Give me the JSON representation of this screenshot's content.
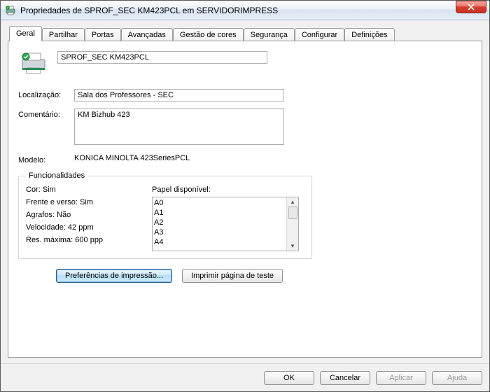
{
  "window": {
    "title": "Propriedades de SPROF_SEC KM423PCL em SERVIDORIMPRESS"
  },
  "tabs": [
    {
      "label": "Geral"
    },
    {
      "label": "Partilhar"
    },
    {
      "label": "Portas"
    },
    {
      "label": "Avançadas"
    },
    {
      "label": "Gestão de cores"
    },
    {
      "label": "Segurança"
    },
    {
      "label": "Configurar"
    },
    {
      "label": "Definições"
    }
  ],
  "general": {
    "name_value": "SPROF_SEC KM423PCL",
    "location_label": "Localização:",
    "location_value": "Sala dos Professores - SEC",
    "comment_label": "Comentário:",
    "comment_value": "KM Bizhub 423",
    "model_label": "Modelo:",
    "model_value": "KONICA MINOLTA 423SeriesPCL"
  },
  "features": {
    "legend": "Funcionalidades",
    "color": "Cor: Sim",
    "duplex": "Frente e verso: Sim",
    "staple": "Agrafos: Não",
    "speed": "Velocidade: 42 ppm",
    "maxres": "Res. máxima: 600 ppp",
    "paper_header": "Papel disponível:",
    "paper_items": [
      "A0",
      "A1",
      "A2",
      "A3",
      "A4"
    ]
  },
  "buttons": {
    "prefs": "Preferências de impressão...",
    "testpage": "Imprimir página de teste"
  },
  "bottom": {
    "ok": "OK",
    "cancel": "Cancelar",
    "apply": "Aplicar",
    "help": "Ajuda"
  }
}
